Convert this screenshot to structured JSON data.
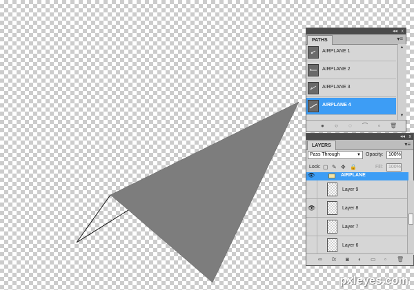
{
  "canvas": {
    "description_note": "",
    "shape_color": "#7d7d7d"
  },
  "paths_panel": {
    "collapse_glyph": "◂◂",
    "close_glyph": "x",
    "tab_label": "PATHS",
    "menu_glyph": "▾≡",
    "items": [
      {
        "label": "AIRPLANE 1",
        "selected": false
      },
      {
        "label": "AIRPLANE 2",
        "selected": false
      },
      {
        "label": "AIRPLANE 3",
        "selected": false
      },
      {
        "label": "AIRPLANE 4",
        "selected": true
      }
    ],
    "scroll_up": "▲",
    "scroll_down": "▼",
    "footer_icons": [
      "fill-path-icon",
      "stroke-path-icon",
      "load-selection-icon",
      "make-work-path-icon",
      "new-path-icon",
      "delete-path-icon"
    ],
    "footer_glyphs": [
      "●",
      "○",
      "◌",
      "⌒",
      "▫",
      "🗑"
    ]
  },
  "layers_panel": {
    "collapse_glyph": "◂◂",
    "close_glyph": "x",
    "tab_label": "LAYERS",
    "menu_glyph": "▾≡",
    "blend_mode": "Pass Through",
    "blend_arrow": "▼",
    "opacity_label": "Opacity:",
    "opacity_value": "100%",
    "lock_label": "Lock:",
    "fill_label": "Fill:",
    "fill_value": "100%",
    "lock_glyphs": [
      "▢",
      "✎",
      "✥",
      "🔒"
    ],
    "group": {
      "name": "AIRPLANE",
      "visible": true
    },
    "layers": [
      {
        "name": "Layer 9",
        "visible": false
      },
      {
        "name": "Layer 8",
        "visible": true
      },
      {
        "name": "Layer 7",
        "visible": false
      },
      {
        "name": "Layer 6",
        "visible": false
      }
    ],
    "eye_glyph": "👁",
    "footer_glyphs": [
      "∞",
      "fx",
      "◙",
      "◐",
      "▭",
      "▫",
      "🗑"
    ]
  },
  "watermark": "pxleyes.com"
}
